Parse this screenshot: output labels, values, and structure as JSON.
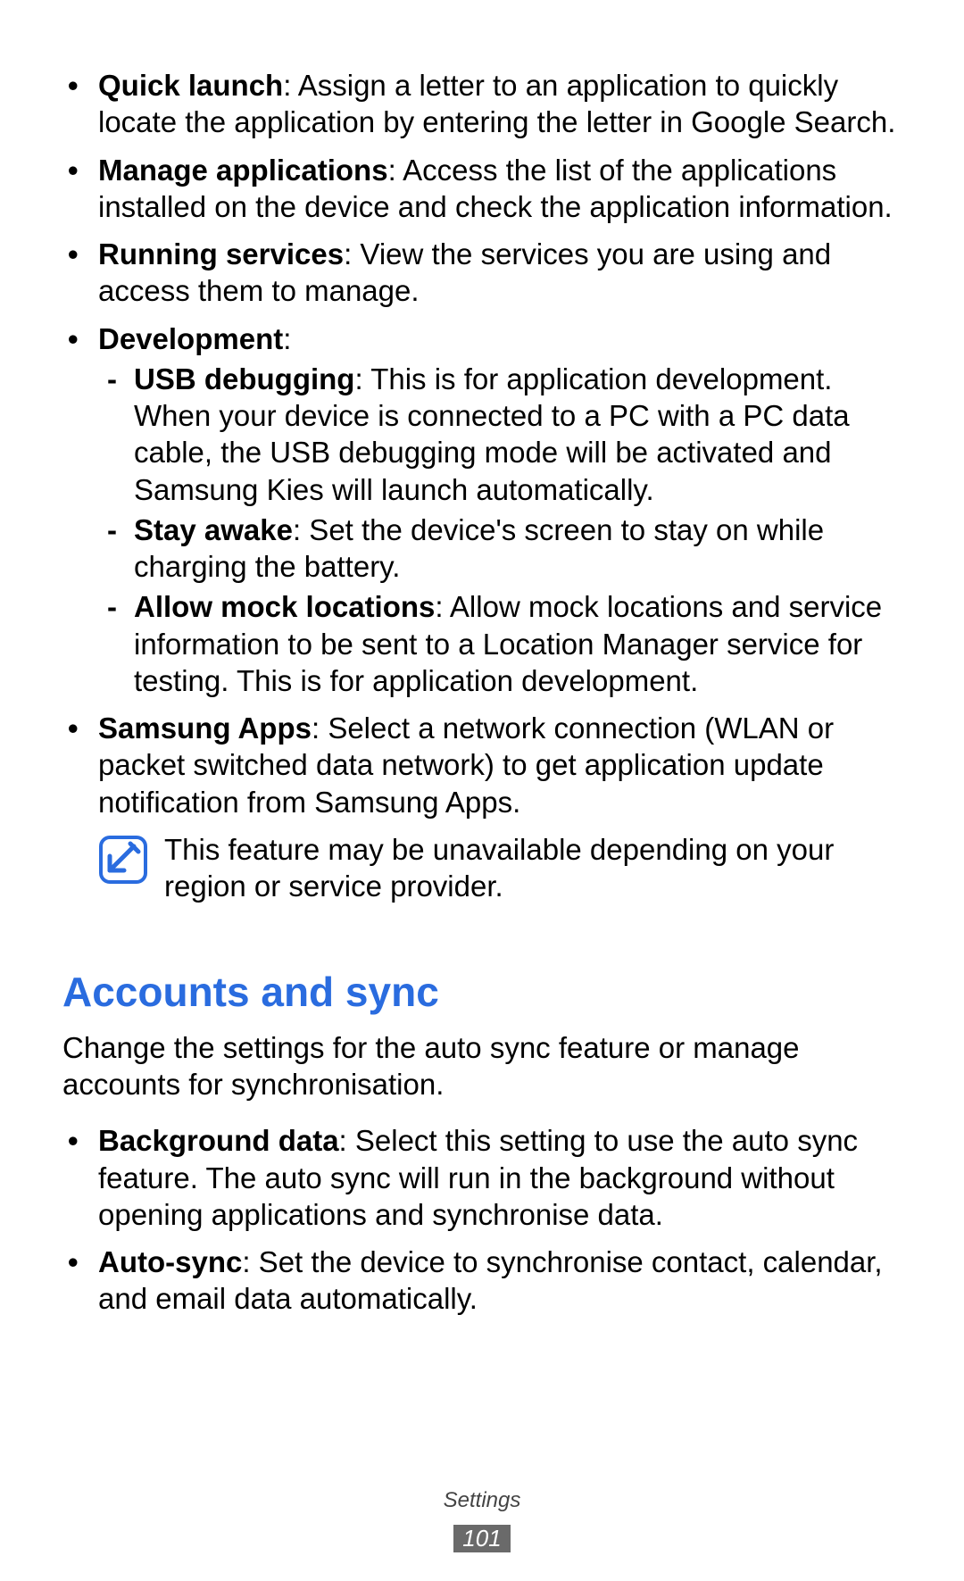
{
  "list1": {
    "items": [
      {
        "term": "Quick launch",
        "desc": ": Assign a letter to an application to quickly locate the application by entering the letter in Google Search."
      },
      {
        "term": "Manage applications",
        "desc": ": Access the list of the applications installed on the device and check the application information."
      },
      {
        "term": "Running services",
        "desc": ": View the services you are using and access them to manage."
      },
      {
        "term": "Development",
        "desc": ":",
        "sub": [
          {
            "term": "USB debugging",
            "desc": ": This is for application development. When your device is connected to a PC with a PC data cable, the USB debugging mode will be activated and Samsung Kies will launch automatically."
          },
          {
            "term": "Stay awake",
            "desc": ": Set the device's screen to stay on while charging the battery."
          },
          {
            "term": "Allow mock locations",
            "desc": ": Allow mock locations and service information to be sent to a Location Manager service for testing. This is for application development."
          }
        ]
      },
      {
        "term": "Samsung Apps",
        "desc": ": Select a network connection (WLAN or packet switched data network) to get application update notification from Samsung Apps."
      }
    ]
  },
  "note": {
    "text": "This feature may be unavailable depending on your region or service provider."
  },
  "section2": {
    "title": "Accounts and sync",
    "intro": "Change the settings for the auto sync feature or manage accounts for synchronisation.",
    "items": [
      {
        "term": "Background data",
        "desc": ": Select this setting to use the auto sync feature. The auto sync will run in the background without opening applications and synchronise data."
      },
      {
        "term": "Auto-sync",
        "desc": ": Set the device to synchronise contact, calendar, and email data automatically."
      }
    ]
  },
  "footer": {
    "section": "Settings",
    "page": "101"
  }
}
